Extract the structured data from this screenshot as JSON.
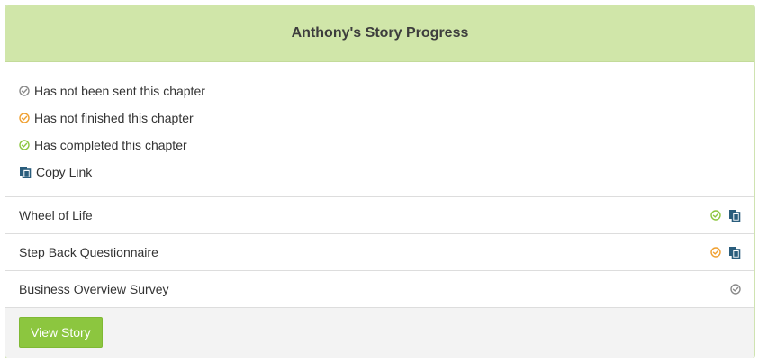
{
  "panel": {
    "title": "Anthony's Story Progress"
  },
  "legend": {
    "items": [
      {
        "label": "Has not been sent this chapter",
        "icon": "check-circle-icon",
        "color": "#8a8a8a"
      },
      {
        "label": "Has not finished this chapter",
        "icon": "check-circle-icon",
        "color": "#f0a030"
      },
      {
        "label": "Has completed this chapter",
        "icon": "check-circle-icon",
        "color": "#8cc63f"
      },
      {
        "label": "Copy Link",
        "icon": "copy-icon",
        "color": "#2a5d7c"
      }
    ]
  },
  "chapters": [
    {
      "title": "Wheel of Life",
      "status": "completed",
      "status_color": "#8cc63f",
      "copy_link": true
    },
    {
      "title": "Step Back Questionnaire",
      "status": "not-finished",
      "status_color": "#f0a030",
      "copy_link": true
    },
    {
      "title": "Business Overview Survey",
      "status": "not-sent",
      "status_color": "#8a8a8a",
      "copy_link": false
    }
  ],
  "footer": {
    "view_story_label": "View Story"
  },
  "colors": {
    "header_bg": "#d0e6a9",
    "button_bg": "#8cc63f",
    "footer_bg": "#f3f3f3",
    "copy_icon": "#2a5d7c"
  }
}
